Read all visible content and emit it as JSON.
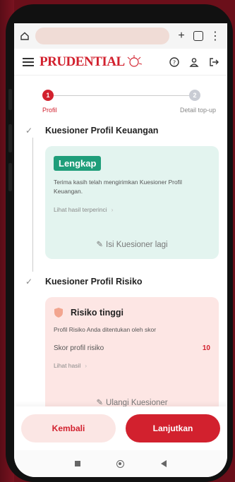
{
  "browser": {
    "home_icon": "home-icon",
    "new_tab_label": "+",
    "tab_count": "·",
    "more_icon": "⋮"
  },
  "header": {
    "logo_text": "PRUDENTIAL",
    "icons": [
      "help-icon",
      "user-icon",
      "logout-icon"
    ]
  },
  "stepper": {
    "steps": [
      {
        "number": "1",
        "label": "Profil"
      },
      {
        "number": "2",
        "label": "Detail top-up"
      }
    ]
  },
  "sections": {
    "financial": {
      "title": "Kuesioner Profil Keuangan",
      "badge": "Lengkap",
      "text": "Terima kasih telah mengirimkan Kuesioner Profil Keuangan.",
      "link": "Lihat hasil terperinci",
      "action": "Isi Kuesioner lagi"
    },
    "risk": {
      "title": "Kuesioner Profil Risiko",
      "heading": "Risiko tinggi",
      "text": "Profil Risiko Anda ditentukan oleh skor",
      "score_label": "Skor profil risiko",
      "score_value": "10",
      "link": "Lihat hasil",
      "action": "Ulangi Kuesioner"
    }
  },
  "footer": {
    "back_label": "Kembali",
    "next_label": "Lanjutkan"
  },
  "colors": {
    "brand": "#d2212e",
    "success": "#1f9e7a"
  }
}
